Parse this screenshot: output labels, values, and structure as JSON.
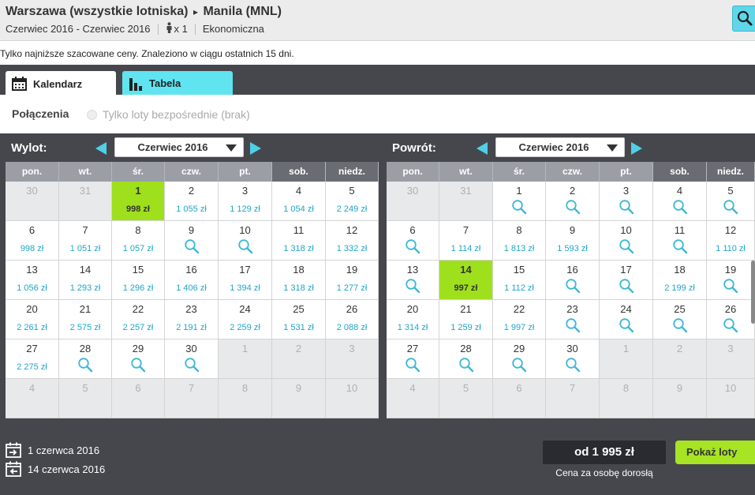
{
  "header": {
    "origin": "Warszawa (wszystkie lotniska)",
    "route_arrow": "▸",
    "destination": "Manila (MNL)",
    "date_range": "Czerwiec 2016 - Czerwiec 2016",
    "passengers": "x 1",
    "cabin": "Ekonomiczna"
  },
  "note": "Tylko najniższe szacowane ceny. Znaleziono w ciągu ostatnich 15 dni.",
  "tabs": [
    {
      "label": "Kalendarz",
      "active": true
    },
    {
      "label": "Tabela",
      "active": false
    }
  ],
  "filter": {
    "title": "Połączenia",
    "direct_label": "Tylko loty bezpośrednie (brak)"
  },
  "weekdays": [
    "pon.",
    "wt.",
    "śr.",
    "czw.",
    "pt.",
    "sob.",
    "niedz."
  ],
  "outbound": {
    "label": "Wylot:",
    "month": "Czerwiec 2016",
    "rows": [
      [
        {
          "d": "30",
          "o": true
        },
        {
          "d": "31",
          "o": true
        },
        {
          "d": "1",
          "p": "998 zł",
          "s": true
        },
        {
          "d": "2",
          "p": "1 055 zł"
        },
        {
          "d": "3",
          "p": "1 129 zł"
        },
        {
          "d": "4",
          "p": "1 054 zł"
        },
        {
          "d": "5",
          "p": "2 249 zł"
        }
      ],
      [
        {
          "d": "6",
          "p": "998 zł"
        },
        {
          "d": "7",
          "p": "1 051 zł"
        },
        {
          "d": "8",
          "p": "1 057 zł"
        },
        {
          "d": "9",
          "m": true
        },
        {
          "d": "10",
          "m": true
        },
        {
          "d": "11",
          "p": "1 318 zł"
        },
        {
          "d": "12",
          "p": "1 332 zł"
        }
      ],
      [
        {
          "d": "13",
          "p": "1 056 zł"
        },
        {
          "d": "14",
          "p": "1 293 zł"
        },
        {
          "d": "15",
          "p": "1 296 zł"
        },
        {
          "d": "16",
          "p": "1 406 zł"
        },
        {
          "d": "17",
          "p": "1 394 zł"
        },
        {
          "d": "18",
          "p": "1 318 zł"
        },
        {
          "d": "19",
          "p": "1 277 zł"
        }
      ],
      [
        {
          "d": "20",
          "p": "2 261 zł"
        },
        {
          "d": "21",
          "p": "2 575 zł"
        },
        {
          "d": "22",
          "p": "2 257 zł"
        },
        {
          "d": "23",
          "p": "2 191 zł"
        },
        {
          "d": "24",
          "p": "2 259 zł"
        },
        {
          "d": "25",
          "p": "1 531 zł"
        },
        {
          "d": "26",
          "p": "2 088 zł"
        }
      ],
      [
        {
          "d": "27",
          "p": "2 275 zł"
        },
        {
          "d": "28",
          "m": true
        },
        {
          "d": "29",
          "m": true
        },
        {
          "d": "30",
          "m": true
        },
        {
          "d": "1",
          "o": true
        },
        {
          "d": "2",
          "o": true
        },
        {
          "d": "3",
          "o": true
        }
      ],
      [
        {
          "d": "4",
          "o": true
        },
        {
          "d": "5",
          "o": true
        },
        {
          "d": "6",
          "o": true
        },
        {
          "d": "7",
          "o": true
        },
        {
          "d": "8",
          "o": true
        },
        {
          "d": "9",
          "o": true
        },
        {
          "d": "10",
          "o": true
        }
      ]
    ]
  },
  "inbound": {
    "label": "Powrót:",
    "month": "Czerwiec 2016",
    "rows": [
      [
        {
          "d": "30",
          "o": true
        },
        {
          "d": "31",
          "o": true
        },
        {
          "d": "1",
          "m": true
        },
        {
          "d": "2",
          "m": true
        },
        {
          "d": "3",
          "m": true
        },
        {
          "d": "4",
          "m": true
        },
        {
          "d": "5",
          "m": true
        }
      ],
      [
        {
          "d": "6",
          "m": true
        },
        {
          "d": "7",
          "p": "1 114 zł"
        },
        {
          "d": "8",
          "p": "1 813 zł"
        },
        {
          "d": "9",
          "p": "1 593 zł"
        },
        {
          "d": "10",
          "m": true
        },
        {
          "d": "11",
          "m": true
        },
        {
          "d": "12",
          "p": "1 110 zł"
        }
      ],
      [
        {
          "d": "13",
          "m": true
        },
        {
          "d": "14",
          "p": "997 zł",
          "s": true
        },
        {
          "d": "15",
          "p": "1 112 zł"
        },
        {
          "d": "16",
          "m": true
        },
        {
          "d": "17",
          "m": true
        },
        {
          "d": "18",
          "p": "2 199 zł"
        },
        {
          "d": "19",
          "m": true
        }
      ],
      [
        {
          "d": "20",
          "p": "1 314 zł"
        },
        {
          "d": "21",
          "p": "1 259 zł"
        },
        {
          "d": "22",
          "p": "1 997 zł"
        },
        {
          "d": "23",
          "m": true
        },
        {
          "d": "24",
          "m": true
        },
        {
          "d": "25",
          "m": true
        },
        {
          "d": "26",
          "m": true
        }
      ],
      [
        {
          "d": "27",
          "m": true
        },
        {
          "d": "28",
          "m": true
        },
        {
          "d": "29",
          "m": true
        },
        {
          "d": "30",
          "m": true
        },
        {
          "d": "1",
          "o": true
        },
        {
          "d": "2",
          "o": true
        },
        {
          "d": "3",
          "o": true
        }
      ],
      [
        {
          "d": "4",
          "o": true
        },
        {
          "d": "5",
          "o": true
        },
        {
          "d": "6",
          "o": true
        },
        {
          "d": "7",
          "o": true
        },
        {
          "d": "8",
          "o": true
        },
        {
          "d": "9",
          "o": true
        },
        {
          "d": "10",
          "o": true
        }
      ]
    ]
  },
  "footer": {
    "depart_date": "1 czerwca 2016",
    "return_date": "14 czerwca 2016",
    "price": "od 1 995 zł",
    "price_note": "Cena za osobę dorosłą",
    "show_button": "Pokaż loty"
  },
  "colors": {
    "accent": "#5fe4f0",
    "selected": "#9fe01d",
    "price_text": "#1fa6c6",
    "panel": "#46474d"
  }
}
